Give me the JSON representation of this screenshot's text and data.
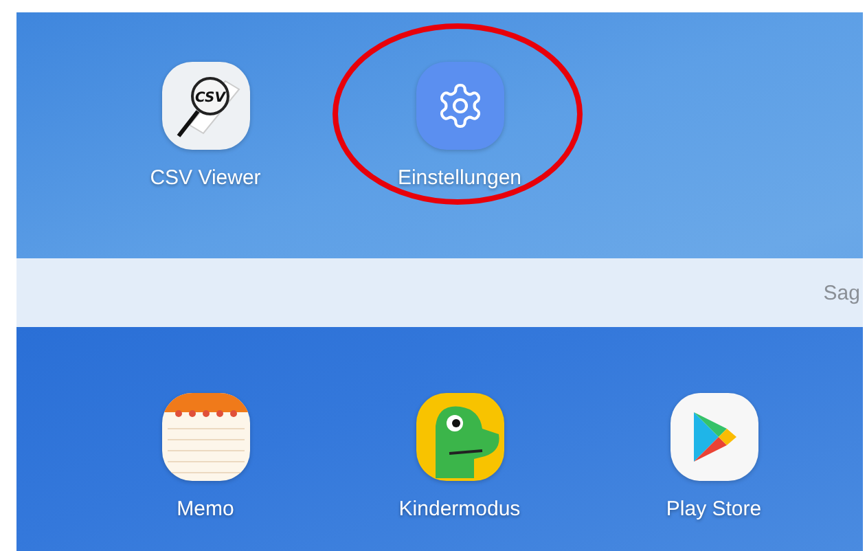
{
  "top_apps": [
    {
      "kind": "csv",
      "label": "CSV Viewer",
      "icon_text": "CSV",
      "highlighted": false
    },
    {
      "kind": "settings",
      "label": "Einstellungen",
      "highlighted": true
    }
  ],
  "search_bar": {
    "hint": "Sag"
  },
  "dock_apps": [
    {
      "kind": "memo",
      "label": "Memo",
      "highlighted": false
    },
    {
      "kind": "kids",
      "label": "Kindermodus",
      "highlighted": false
    },
    {
      "kind": "play",
      "label": "Play Store",
      "highlighted": false
    }
  ]
}
